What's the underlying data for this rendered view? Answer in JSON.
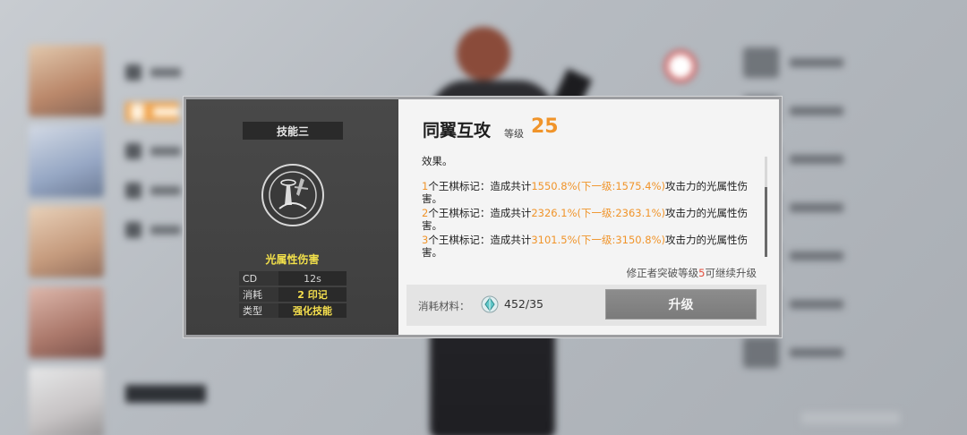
{
  "skill_panel": {
    "tab_label": "技能三",
    "icon": "skill-emblem-icon",
    "element_name": "光属性伤害",
    "stats": [
      {
        "key": "CD",
        "value": "12s"
      },
      {
        "key": "消耗",
        "value": "2 印记"
      },
      {
        "key": "类型",
        "value": "强化技能"
      }
    ]
  },
  "detail": {
    "title": "同翼互攻",
    "level_label": "等级",
    "level_value": "25",
    "desc_intro": "效果。",
    "lines": [
      {
        "count": "1",
        "pre": "个王棋标记：造成共计",
        "cur": "1550.8%(下一级:1575.4%)",
        "post": "攻击力的光属性伤害。"
      },
      {
        "count": "2",
        "pre": "个王棋标记：造成共计",
        "cur": "2326.1%(下一级:2363.1%)",
        "post": "攻击力的光属性伤害。"
      },
      {
        "count": "3",
        "pre": "个王棋标记：造成共计",
        "cur": "3101.5%(下一级:3150.8%)",
        "post": "攻击力的光属性伤害。"
      }
    ],
    "upgrade_note_pre": "修正者突破等级",
    "upgrade_note_num": "5",
    "upgrade_note_post": "可继续升级"
  },
  "material": {
    "label": "消耗材料：",
    "icon": "crystal-material-icon",
    "count": "452/35",
    "upgrade_button": "升级"
  },
  "colors": {
    "accent_orange": "#f0942a",
    "skill_yellow": "#f2e04a",
    "note_red": "#e24b3b"
  }
}
